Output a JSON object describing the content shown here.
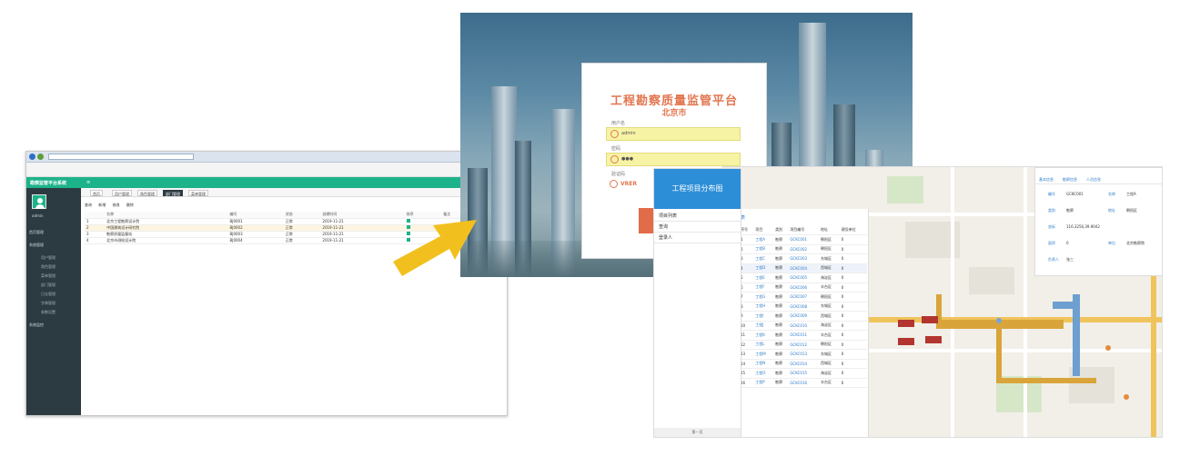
{
  "admin": {
    "header_title": "勘察监管平台系统",
    "toggle": "≡",
    "sidebar": {
      "user": "admin",
      "items": [
        "首页管理",
        "系统管理",
        "用户管理",
        "角色管理",
        "菜单管理",
        "部门管理",
        "日志管理",
        "字典管理",
        "参数设置",
        "系统监控"
      ]
    },
    "tabs": [
      "首页",
      "用户管理",
      "角色管理",
      "部门管理",
      "菜单管理"
    ],
    "toolbar": [
      "查询",
      "新增",
      "修改",
      "删除"
    ],
    "table": {
      "headers": [
        "",
        "名称",
        "编号",
        "状态",
        "创建时间",
        "排序",
        "备注"
      ],
      "rows": [
        [
          "1",
          "北京工程勘察设计院",
          "BJ0001",
          "正常",
          "2019-11-21",
          "1",
          ""
        ],
        [
          "2",
          "中国建筑设计研究院",
          "BJ0002",
          "正常",
          "2019-11-21",
          "2",
          ""
        ],
        [
          "3",
          "勘察质量监督站",
          "BJ0003",
          "正常",
          "2019-11-21",
          "3",
          "勘察单位"
        ],
        [
          "4",
          "北京市测绘设计院",
          "BJ0004",
          "正常",
          "2019-11-21",
          "4",
          ""
        ]
      ]
    }
  },
  "login": {
    "title": "工程勘察质量监管平台",
    "city": "北京市",
    "user_label": "用户名",
    "user_value": "admin",
    "pwd_label": "密码",
    "pwd_value": "●●●",
    "captcha_label": "验证码",
    "captcha_value": "VRER"
  },
  "mobile": {
    "header": "工程项目分布图",
    "items": [
      "项目列表",
      "查询",
      "登录人"
    ],
    "footer": "第一页"
  },
  "map": {
    "list_caption": "项目列表",
    "list_headers": [
      "序号",
      "项目",
      "类别",
      "项目编号",
      "地址",
      "建设单位",
      "勘察单位",
      "操作"
    ],
    "rows": [
      [
        "1",
        "工程A",
        "勘察",
        "GCKC001",
        "朝阳区",
        "0"
      ],
      [
        "2",
        "工程B",
        "勘察",
        "GCKC002",
        "朝阳区",
        "0"
      ],
      [
        "3",
        "工程C",
        "勘察",
        "GCKC003",
        "东城区",
        "0"
      ],
      [
        "4",
        "工程D",
        "勘察",
        "GCKC004",
        "西城区",
        "0"
      ],
      [
        "5",
        "工程E",
        "勘察",
        "GCKC005",
        "海淀区",
        "0"
      ],
      [
        "6",
        "工程F",
        "勘察",
        "GCKC006",
        "丰台区",
        "0"
      ],
      [
        "7",
        "工程G",
        "勘察",
        "GCKC007",
        "朝阳区",
        "0"
      ],
      [
        "8",
        "工程H",
        "勘察",
        "GCKC008",
        "东城区",
        "0"
      ],
      [
        "9",
        "工程I",
        "勘察",
        "GCKC009",
        "西城区",
        "0"
      ],
      [
        "10",
        "工程J",
        "勘察",
        "GCKC010",
        "海淀区",
        "0"
      ],
      [
        "11",
        "工程K",
        "勘察",
        "GCKC011",
        "丰台区",
        "0"
      ],
      [
        "12",
        "工程L",
        "勘察",
        "GCKC012",
        "朝阳区",
        "0"
      ],
      [
        "13",
        "工程M",
        "勘察",
        "GCKC013",
        "东城区",
        "0"
      ],
      [
        "14",
        "工程N",
        "勘察",
        "GCKC014",
        "西城区",
        "0"
      ],
      [
        "15",
        "工程O",
        "勘察",
        "GCKC015",
        "海淀区",
        "0"
      ],
      [
        "16",
        "工程P",
        "勘察",
        "GCKC016",
        "丰台区",
        "0"
      ]
    ],
    "panel_tabs": [
      "基本信息",
      "勘察信息",
      "人员信息"
    ],
    "panel_fields": [
      [
        "编号",
        "GCKC001"
      ],
      [
        "名称",
        "工程A"
      ],
      [
        "类别",
        "勘察"
      ],
      [
        "地址",
        "朝阳区"
      ],
      [
        "坐标",
        "116.3256,39.9042"
      ],
      [
        "面积",
        "0"
      ],
      [
        "单位",
        "北京勘察院"
      ],
      [
        "负责人",
        "张三"
      ]
    ]
  }
}
